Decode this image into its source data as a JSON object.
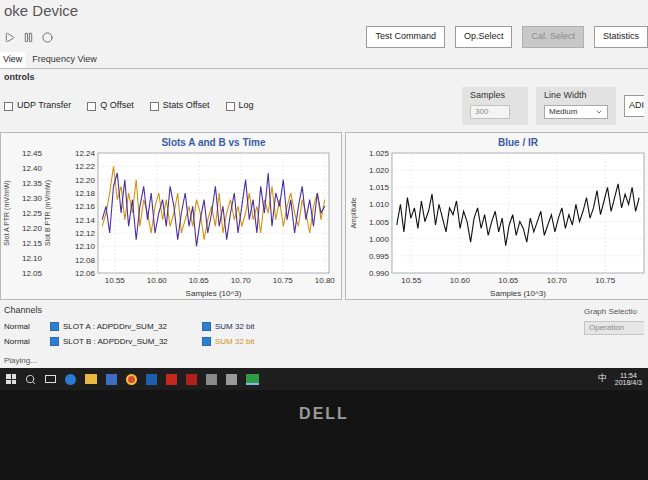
{
  "window": {
    "title": "oke Device"
  },
  "toolbar": {
    "buttons": [
      {
        "label": "Test Command",
        "disabled": false
      },
      {
        "label": "Op.Select",
        "disabled": false
      },
      {
        "label": "Cal. Select",
        "disabled": true
      },
      {
        "label": "Statistics",
        "disabled": false
      }
    ]
  },
  "tabs": [
    {
      "label": "View",
      "selected": true
    },
    {
      "label": "Frequency View",
      "selected": false
    }
  ],
  "controls": {
    "title": "ontrols",
    "checkboxes": [
      {
        "label": "UDP Transfer",
        "checked": false
      },
      {
        "label": "Q Offset",
        "checked": false
      },
      {
        "label": "Stats Offset",
        "checked": false
      },
      {
        "label": "Log",
        "checked": false
      }
    ],
    "samples": {
      "label": "Samples",
      "value": "300"
    },
    "line_width": {
      "label": "Line Width",
      "value": "Medium"
    },
    "cut_button": "ADI"
  },
  "charts": [
    {
      "title": "Slots A and B vs Time",
      "x_label": "Samples (10^3)",
      "y_labels": [
        "Slot A PTR (mV/mW)",
        "Slot B PTR (mV/mW)"
      ],
      "y_ticks_outer": [
        "12.45",
        "12.40",
        "12.35",
        "12.30",
        "12.25",
        "12.20",
        "12.15",
        "12.10",
        "12.05"
      ],
      "y_ticks": [
        "12.24",
        "12.22",
        "12.20",
        "12.18",
        "12.16",
        "12.14",
        "12.12",
        "12.10",
        "12.08",
        "12.06"
      ],
      "x_ticks": [
        "10.55",
        "10.60",
        "10.65",
        "10.70",
        "10.75",
        "10.80"
      ],
      "series": [
        {
          "name": "SLOT B",
          "color": "#d4930e",
          "values": [
            12.13,
            12.15,
            12.18,
            12.22,
            12.17,
            12.19,
            12.14,
            12.18,
            12.15,
            12.2,
            12.13,
            12.17,
            12.15,
            12.12,
            12.16,
            12.18,
            12.14,
            12.17,
            12.13,
            12.15,
            12.18,
            12.12,
            12.14,
            12.16,
            12.13,
            12.17,
            12.15,
            12.11,
            12.14,
            12.16,
            12.13,
            12.18,
            12.12,
            12.15,
            12.17,
            12.14,
            12.16,
            12.13,
            12.15,
            12.18,
            12.14,
            12.16,
            12.12,
            12.17,
            12.15,
            12.19,
            12.14,
            12.17,
            12.13,
            12.16,
            12.18,
            12.15,
            12.13,
            12.17,
            12.15,
            12.12,
            12.16,
            12.18,
            12.14,
            12.17
          ]
        },
        {
          "name": "SLOT A",
          "color": "#4b2fa0",
          "values": [
            12.14,
            12.16,
            12.12,
            12.19,
            12.21,
            12.15,
            12.2,
            12.13,
            12.17,
            12.11,
            12.16,
            12.19,
            12.14,
            12.18,
            12.12,
            12.15,
            12.17,
            12.13,
            12.19,
            12.16,
            12.11,
            12.15,
            12.18,
            12.13,
            12.16,
            12.1,
            12.14,
            12.17,
            12.12,
            12.15,
            12.19,
            12.13,
            12.16,
            12.11,
            12.15,
            12.18,
            12.12,
            12.16,
            12.2,
            12.14,
            12.17,
            12.12,
            12.19,
            12.15,
            12.21,
            12.13,
            12.18,
            12.16,
            12.2,
            12.14,
            12.17,
            12.12,
            12.16,
            12.19,
            12.14,
            12.17,
            12.13,
            12.18,
            12.15,
            12.16
          ]
        }
      ]
    },
    {
      "title": "Blue / IR",
      "x_label": "Samples (10^3)",
      "y_labels": [
        "Amplitude"
      ],
      "y_ticks": [
        "1.025",
        "1.020",
        "1.015",
        "1.010",
        "1.005",
        "1.000",
        "0.995",
        "0.990"
      ],
      "x_ticks": [
        "10.55",
        "10.60",
        "10.65",
        "10.70",
        "10.75"
      ],
      "series": [
        {
          "name": "Blue / IR",
          "color": "#111111",
          "values": [
            1.004,
            1.01,
            1.002,
            1.012,
            1.006,
            1.009,
            1.003,
            1.011,
            1.005,
            1.008,
            1.013,
            1.004,
            1.01,
            1.006,
            1.002,
            1.009,
            1.007,
            1.011,
            1.003,
            1.008,
            1.005,
            0.999,
            1.006,
            1.009,
            1.003,
            1.007,
            1.001,
            1.005,
            1.008,
            1.002,
            1.006,
            0.998,
            1.004,
            1.007,
            1.001,
            1.005,
            1.003,
            0.999,
            1.006,
            1.002,
            1.005,
            1.008,
            1.001,
            1.004,
            1.007,
            1.002,
            1.006,
            1.009,
            1.003,
            1.007,
            1.004,
            1.01,
            1.005,
            1.008,
            1.012,
            1.006,
            1.009,
            1.014,
            1.007,
            1.011,
            1.015,
            1.008,
            1.012,
            1.016,
            1.009,
            1.013,
            1.01,
            1.015,
            1.008,
            1.012
          ]
        }
      ]
    }
  ],
  "channels": {
    "title": "Channels",
    "rows": [
      {
        "mode": "Normal",
        "checked": true,
        "slot": "SLOT A : ADPDDrv_SUM_32",
        "legend_checked": true,
        "legend": "SUM 32 bit",
        "color": "#2b2b55"
      },
      {
        "mode": "Normal",
        "checked": true,
        "slot": "SLOT B : ADPDDrv_SUM_32",
        "legend_checked": true,
        "legend": "SUM 32 bit",
        "color": "#d4930e"
      }
    ],
    "graph_selection": {
      "label": "Graph Selectio",
      "value": "Operation"
    }
  },
  "status": "Playing...",
  "taskbar": {
    "tray": "中",
    "time": "11:54",
    "date": "2018/4/3"
  },
  "bezel": {
    "logo": "DELL"
  }
}
